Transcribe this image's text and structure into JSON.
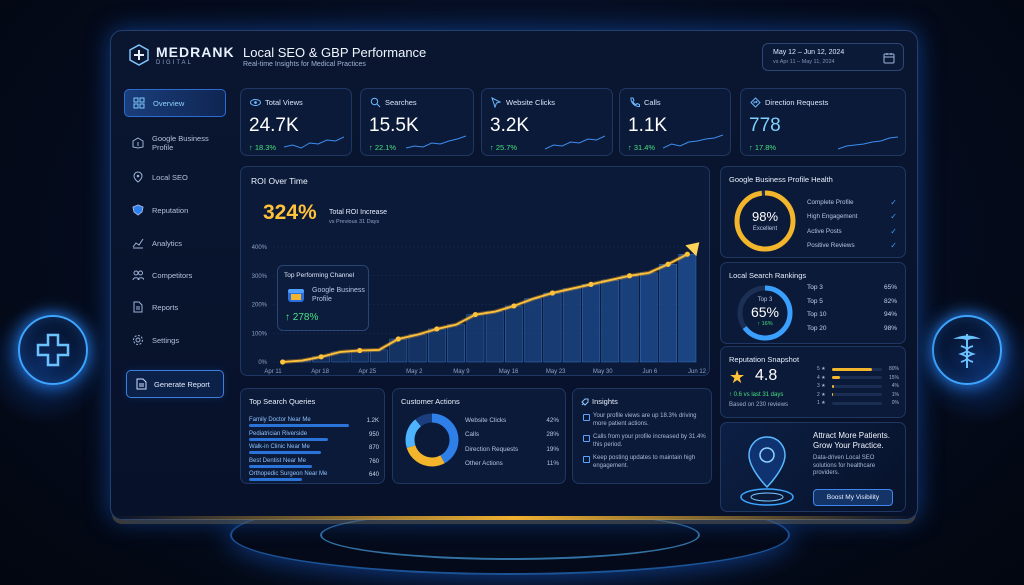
{
  "brand": {
    "name": "MEDRANK",
    "sub": "DIGITAL"
  },
  "header": {
    "title": "Local SEO & GBP Performance",
    "subtitle": "Real-time Insights for Medical Practices",
    "date_range": "May 12 – Jun 12, 2024",
    "compare_range": "vs Apr 11 – May 11, 2024",
    "calendar_icon": "calendar-icon"
  },
  "sidebar": {
    "items": [
      {
        "label": "Overview",
        "icon": "grid-icon",
        "active": true
      },
      {
        "label": "Google Business Profile",
        "icon": "building-icon",
        "active": false
      },
      {
        "label": "Local SEO",
        "icon": "location-pin-icon",
        "active": false
      },
      {
        "label": "Reputation",
        "icon": "shield-icon",
        "active": false
      },
      {
        "label": "Analytics",
        "icon": "chart-icon",
        "active": false
      },
      {
        "label": "Competitors",
        "icon": "users-icon",
        "active": false
      },
      {
        "label": "Reports",
        "icon": "document-icon",
        "active": false
      },
      {
        "label": "Settings",
        "icon": "gear-icon",
        "active": false
      }
    ],
    "generate_label": "Generate Report"
  },
  "stats": [
    {
      "label": "Total Views",
      "value": "24.7K",
      "change": "↑ 18.3%",
      "icon": "eye-icon"
    },
    {
      "label": "Searches",
      "value": "15.5K",
      "change": "↑ 22.1%",
      "icon": "search-icon"
    },
    {
      "label": "Website Clicks",
      "value": "3.2K",
      "change": "↑ 25.7%",
      "icon": "cursor-icon"
    },
    {
      "label": "Calls",
      "value": "1.1K",
      "change": "↑ 31.4%",
      "icon": "phone-icon"
    },
    {
      "label": "Direction Requests",
      "value": "778",
      "change": "↑ 17.8%",
      "icon": "directions-icon"
    }
  ],
  "roi": {
    "title": "ROI Over Time",
    "big_value": "324%",
    "big_label": "Total ROI Increase",
    "big_sub": "vs Previous 31 Days",
    "channel_title": "Top Performing Channel",
    "channel_name": "Google Business Profile",
    "channel_pct": "↑ 278%"
  },
  "chart_data": {
    "type": "line",
    "title": "ROI Over Time",
    "x": [
      "Apr 11",
      "Apr 18",
      "Apr 25",
      "May 2",
      "May 9",
      "May 16",
      "May 23",
      "May 30",
      "Jun 6",
      "Jun 12"
    ],
    "yticks": [
      "0%",
      "100%",
      "200%",
      "300%",
      "400%"
    ],
    "ylim": [
      0,
      400
    ],
    "series": [
      {
        "values": [
          0,
          5,
          18,
          35,
          40,
          42,
          80,
          95,
          115,
          130,
          165,
          175,
          195,
          220,
          240,
          255,
          270,
          285,
          300,
          310,
          340,
          375
        ]
      }
    ],
    "bars": [
      0,
      5,
      18,
      35,
      40,
      42,
      80,
      95,
      115,
      130,
      165,
      175,
      195,
      220,
      240,
      255,
      270,
      285,
      300,
      310,
      340,
      375
    ]
  },
  "gbp_health": {
    "title": "Google Business Profile Health",
    "pct": "98%",
    "pct_value": 98,
    "status": "Excellent",
    "checks": [
      "Complete Profile",
      "High Engagement",
      "Active Posts",
      "Positive Reviews"
    ]
  },
  "rankings": {
    "title": "Local Search Rankings",
    "top_label": "Top 3",
    "pct": "65%",
    "pct_value": 65,
    "change": "↑ 16%",
    "rows": [
      {
        "label": "Top 3",
        "value": "65%"
      },
      {
        "label": "Top 5",
        "value": "82%"
      },
      {
        "label": "Top 10",
        "value": "94%"
      },
      {
        "label": "Top 20",
        "value": "98%"
      }
    ]
  },
  "reputation": {
    "title": "Reputation Snapshot",
    "score": "4.8",
    "change": "↑ 0.6 vs last 31 days",
    "based": "Based on 230 reviews",
    "rows": [
      {
        "stars": "5 ★",
        "pct": "80%",
        "fill": 0.8
      },
      {
        "stars": "4 ★",
        "pct": "15%",
        "fill": 0.15
      },
      {
        "stars": "3 ★",
        "pct": "4%",
        "fill": 0.04
      },
      {
        "stars": "2 ★",
        "pct": "1%",
        "fill": 0.01
      },
      {
        "stars": "1 ★",
        "pct": "0%",
        "fill": 0
      }
    ]
  },
  "promo": {
    "title": "Attract More Patients. Grow Your Practice.",
    "text": "Data-driven Local SEO solutions for healthcare providers.",
    "button": "Boost My Visibility"
  },
  "queries": {
    "title": "Top Search Queries",
    "rows": [
      {
        "label": "Family Doctor Near Me",
        "value": "1.2K",
        "fill": 1.0
      },
      {
        "label": "Pediatrician Riverside",
        "value": "950",
        "fill": 0.79
      },
      {
        "label": "Walk-in Clinic Near Me",
        "value": "870",
        "fill": 0.72
      },
      {
        "label": "Best Dentist Near Me",
        "value": "760",
        "fill": 0.63
      },
      {
        "label": "Orthopedic Surgeon Near Me",
        "value": "640",
        "fill": 0.53
      }
    ]
  },
  "customer_actions": {
    "title": "Customer Actions",
    "rows": [
      {
        "label": "Website Clicks",
        "value": "42%",
        "color": "#2e7fe8",
        "share": 42
      },
      {
        "label": "Calls",
        "value": "28%",
        "color": "#f2b52c",
        "share": 28
      },
      {
        "label": "Direction Requests",
        "value": "19%",
        "color": "#4fb4ff",
        "share": 19
      },
      {
        "label": "Other Actions",
        "value": "11%",
        "color": "#1b3f7e",
        "share": 11
      }
    ]
  },
  "insights": {
    "title": "Insights",
    "items": [
      "Your profile views are up 18.3% driving more patient actions.",
      "Calls from your profile increased by 31.4% this period.",
      "Keep posting updates to maintain high engagement."
    ]
  }
}
